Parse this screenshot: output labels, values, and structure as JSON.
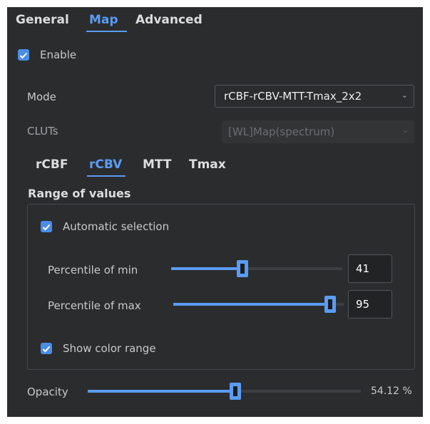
{
  "top_tabs": [
    {
      "label": "General",
      "active": false
    },
    {
      "label": "Map",
      "active": true
    },
    {
      "label": "Advanced",
      "active": false
    }
  ],
  "enable": {
    "label": "Enable",
    "checked": true
  },
  "mode": {
    "label": "Mode",
    "value": "rCBF-rCBV-MTT-Tmax_2x2"
  },
  "cluts": {
    "label": "CLUTs",
    "value": "[WL]Map(spectrum)",
    "disabled": true
  },
  "map_tabs": [
    {
      "label": "rCBF",
      "active": false
    },
    {
      "label": "rCBV",
      "active": true
    },
    {
      "label": "MTT",
      "active": false
    },
    {
      "label": "Tmax",
      "active": false
    }
  ],
  "range": {
    "title": "Range of values",
    "automatic": {
      "label": "Automatic selection",
      "checked": true
    },
    "min": {
      "label": "Percentile of min",
      "value": "41",
      "level": 0.41
    },
    "max": {
      "label": "Percentile of max",
      "value": "95",
      "level": 0.95
    },
    "show_color_range": {
      "label": "Show color range",
      "checked": true
    }
  },
  "opacity": {
    "label": "Opacity",
    "value_text": "54.12 %",
    "level": 0.5412
  },
  "colors": {
    "accent": "#5b9cf3",
    "background": "#2b2c2e"
  }
}
